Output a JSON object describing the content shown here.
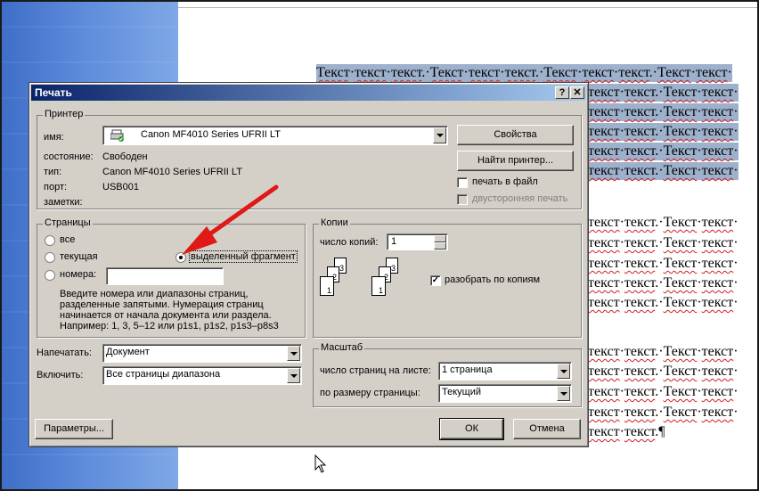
{
  "document": {
    "selected_lines": [
      "Текст·текст·текст.·Текст·текст·текст.·Текст·текст·текст.·Текст·текст·",
      "текст·текст.·Текст·текст·",
      "текст·текст.·Текст·текст·",
      "текст·текст.·Текст·текст·",
      "текст·текст.·Текст·текст·",
      "текст·текст.·Текст·текст·"
    ],
    "body_lines": [
      "текст·текст.·Текст·текст·",
      "текст·текст.·Текст·текст·",
      "текст·текст.·Текст·текст·",
      "текст·текст.·Текст·текст·",
      "текст·текст.·Текст·текст·",
      "текст·текст.·Текст·текст·",
      "текст·текст.·Текст·текст·",
      "текст·текст.·Текст·текст·",
      "текст·текст.·Текст·текст·",
      "текст·текст.¶"
    ]
  },
  "dialog": {
    "title": "Печать",
    "help_button": "?",
    "close_button": "✕",
    "printer": {
      "group_label": "Принтер",
      "name_label": "имя:",
      "name_value": "Canon MF4010 Series UFRII LT",
      "status_label": "состояние:",
      "status_value": "Свободен",
      "type_label": "тип:",
      "type_value": "Canon MF4010 Series UFRII LT",
      "port_label": "порт:",
      "port_value": "USB001",
      "notes_label": "заметки:",
      "properties_button": "Свойства",
      "find_printer_button": "Найти принтер...",
      "print_to_file_label": "печать в файл",
      "duplex_label": "двусторонняя печать"
    },
    "pages": {
      "group_label": "Страницы",
      "all_label": "все",
      "current_label": "текущая",
      "selection_label": "выделенный фрагмент",
      "numbers_label": "номера:",
      "hint_lines": [
        "Введите номера или диапазоны страниц,",
        "разделенные запятыми. Нумерация страниц",
        "начинается от начала документа или раздела.",
        "Например: 1, 3, 5–12 или p1s1, p1s2, p1s3–p8s3"
      ]
    },
    "copies": {
      "group_label": "Копии",
      "count_label": "число копий:",
      "count_value": "1",
      "collate_label": "разобрать по копиям",
      "page_numbers": [
        "1",
        "2",
        "3"
      ]
    },
    "print_what_label": "Напечатать:",
    "print_what_value": "Документ",
    "include_label": "Включить:",
    "include_value": "Все страницы диапазона",
    "zoom": {
      "group_label": "Масштаб",
      "pages_per_sheet_label": "число страниц на листе:",
      "pages_per_sheet_value": "1 страница",
      "scale_label": "по размеру страницы:",
      "scale_value": "Текущий"
    },
    "options_button": "Параметры...",
    "ok_button": "ОК",
    "cancel_button": "Отмена"
  },
  "colors": {
    "annotation_arrow": "#e01818",
    "selection_highlight": "#9db0cc",
    "title_gradient_start": "#0a246a"
  }
}
